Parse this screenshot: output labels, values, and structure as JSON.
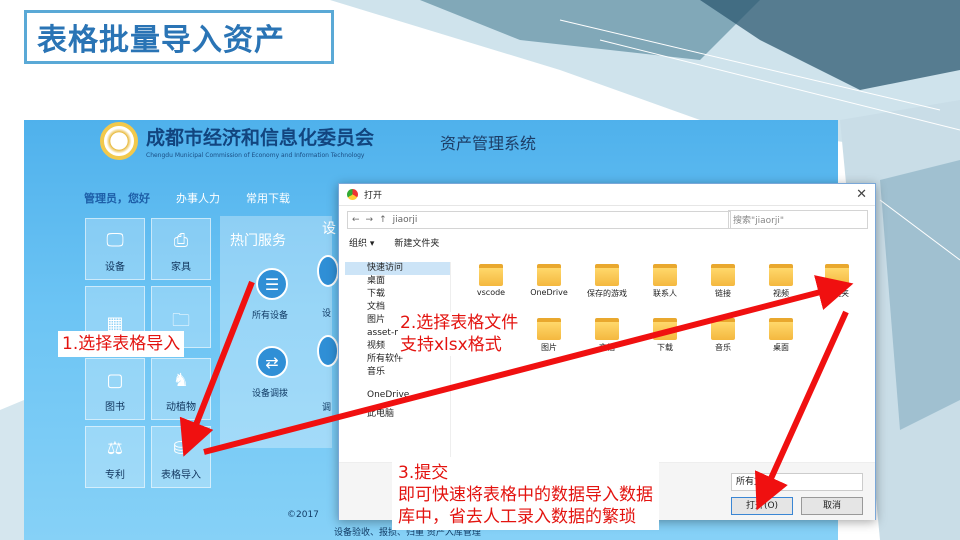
{
  "slide": {
    "title": "表格批量导入资产"
  },
  "app": {
    "org_name": "成都市经济和信息化委员会",
    "org_name_en": "Chengdu Municipal Commission of Economy and Information Technology",
    "system_name": "资产管理系统",
    "nav": [
      "管理员，您好",
      "办事人力",
      "常用下载"
    ],
    "tiles": [
      {
        "label": "设备",
        "icon": "monitor-icon"
      },
      {
        "label": "家具",
        "icon": "printer-icon"
      },
      {
        "label": "",
        "icon": "grid-icon"
      },
      {
        "label": "",
        "icon": "folder-icon"
      },
      {
        "label": "图书",
        "icon": "book-icon"
      },
      {
        "label": "动植物",
        "icon": "deer-icon"
      },
      {
        "label": "专利",
        "icon": "patent-icon"
      },
      {
        "label": "表格导入",
        "icon": "table-import-icon"
      }
    ],
    "hot_services": {
      "title": "热门服务",
      "items": [
        {
          "label": "所有设备",
          "icon": "list-icon"
        },
        {
          "label": "设备调拨",
          "icon": "transfer-icon"
        }
      ]
    },
    "fragments": [
      "设",
      "设",
      "调"
    ],
    "copyright": "©2017",
    "bottom_links": "设备验收、报损、归重 资产入库管理"
  },
  "dialog": {
    "title": "打开",
    "address": "jiaorji",
    "search_placeholder": "搜索\"jiaorji\"",
    "toolbar": [
      "组织 ▾",
      "新建文件夹"
    ],
    "sidebar": [
      "快速访问",
      "桌面",
      "下载",
      "文档",
      "图片",
      "asset-manager",
      "视频",
      "所有软件",
      "音乐",
      "OneDrive",
      "此电脑"
    ],
    "files": [
      {
        "name": "vscode",
        "kind": "folder"
      },
      {
        "name": "OneDrive",
        "kind": "cloud"
      },
      {
        "name": "保存的游戏",
        "kind": "folder"
      },
      {
        "name": "联系人",
        "kind": "folder"
      },
      {
        "name": "链接",
        "kind": "folder"
      },
      {
        "name": "视频",
        "kind": "video"
      },
      {
        "name": "收藏夹",
        "kind": "star"
      },
      {
        "name": "",
        "kind": "folder"
      },
      {
        "name": "图片",
        "kind": "image"
      },
      {
        "name": "文档",
        "kind": "folder"
      },
      {
        "name": "下载",
        "kind": "download"
      },
      {
        "name": "音乐",
        "kind": "music"
      },
      {
        "name": "桌面",
        "kind": "folder"
      }
    ],
    "file_type": "所有文",
    "open_button": "打开(O)",
    "cancel_button": "取消"
  },
  "callouts": {
    "step1": "1.选择表格导入",
    "step2_line1": "2.选择表格文件",
    "step2_line2": "支持xlsx格式",
    "step3_line1": "3.提交",
    "step3_line2": "即可快速将表格中的数据导入数据",
    "step3_line3": "库中，省去人工录入数据的繁琐"
  },
  "colors": {
    "title_blue": "#2a74b5",
    "callout_red": "#e3130f",
    "app_blue": "#4fb1ec"
  }
}
